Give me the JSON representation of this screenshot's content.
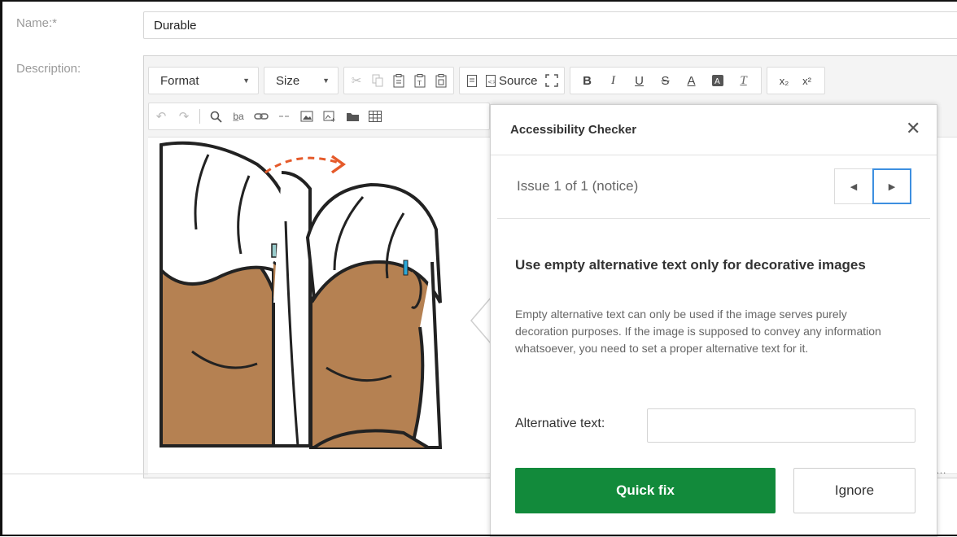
{
  "form": {
    "name_label": "Name:*",
    "name_value": "Durable",
    "description_label": "Description:"
  },
  "toolbar": {
    "format_label": "Format",
    "size_label": "Size",
    "source_label": "Source",
    "bold": "B",
    "italic": "I",
    "underline": "U",
    "strike": "S",
    "text_color": "A",
    "remove_format": "T",
    "subscript": "x₂",
    "superscript": "x²"
  },
  "panel": {
    "title": "Accessibility Checker",
    "close_glyph": "✕",
    "issue_status": "Issue 1 of 1 (notice)",
    "issue_heading": "Use empty alternative text only for decorative images",
    "issue_description": "Empty alternative text can only be used if the image serves purely decoration purposes. If the image is supposed to convey any information whatsoever, you need to set a proper alternative text for it.",
    "alt_label": "Alternative text:",
    "alt_value": "",
    "quick_fix_label": "Quick fix",
    "ignore_label": "Ignore"
  },
  "icons": [
    "cut-icon",
    "copy-icon",
    "paste-icon",
    "paste-text-icon",
    "paste-word-icon",
    "templates-icon",
    "source-icon",
    "maximize-icon",
    "undo-icon",
    "redo-icon",
    "find-icon",
    "replace-icon",
    "link-icon",
    "unlink-icon",
    "image-icon",
    "image-upload-icon",
    "folder-icon",
    "table-icon",
    "close-icon",
    "prev-icon",
    "next-icon"
  ],
  "colors": {
    "accent_green": "#128a3b",
    "focus_blue": "#3d8fe0",
    "skin": "#b58152"
  }
}
